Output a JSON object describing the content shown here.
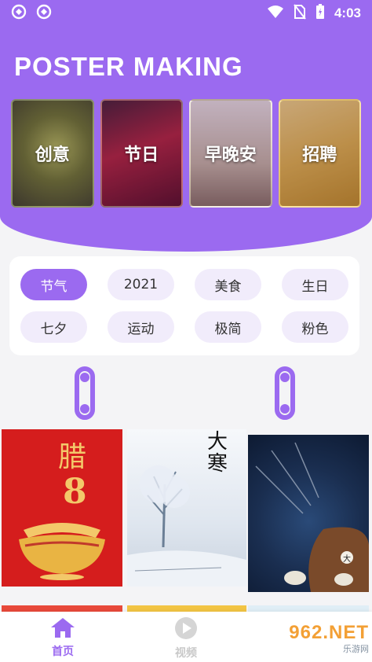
{
  "status_bar": {
    "time": "4:03",
    "icons": [
      "notification-app-icon",
      "notification-app-icon",
      "wifi-icon",
      "no-sim-icon",
      "battery-charging-icon"
    ]
  },
  "header": {
    "title": "POSTER MAKING"
  },
  "category_cards": [
    {
      "label": "创意",
      "icon": "creative-thumbnail"
    },
    {
      "label": "节日",
      "icon": "festival-thumbnail"
    },
    {
      "label": "早晚安",
      "icon": "greeting-thumbnail"
    },
    {
      "label": "招聘",
      "icon": "recruit-thumbnail"
    }
  ],
  "tags": [
    {
      "label": "节气",
      "active": true
    },
    {
      "label": "2021",
      "active": false
    },
    {
      "label": "美食",
      "active": false
    },
    {
      "label": "生日",
      "active": false
    },
    {
      "label": "七夕",
      "active": false
    },
    {
      "label": "运动",
      "active": false
    },
    {
      "label": "极简",
      "active": false
    },
    {
      "label": "粉色",
      "active": false
    }
  ],
  "posters": [
    {
      "title": "腊",
      "number": "8"
    },
    {
      "title": "大寒"
    },
    {
      "badge": "大"
    }
  ],
  "bottom_nav": {
    "items": [
      {
        "label": "首页",
        "icon": "home-icon",
        "active": true
      },
      {
        "label": "视频",
        "icon": "play-icon",
        "active": false
      }
    ]
  },
  "watermark": {
    "top": "962.NET",
    "bottom": "乐游网"
  },
  "colors": {
    "accent": "#9b6af0",
    "tag_bg": "#f1ecfb",
    "page_bg": "#f4f4f6"
  }
}
